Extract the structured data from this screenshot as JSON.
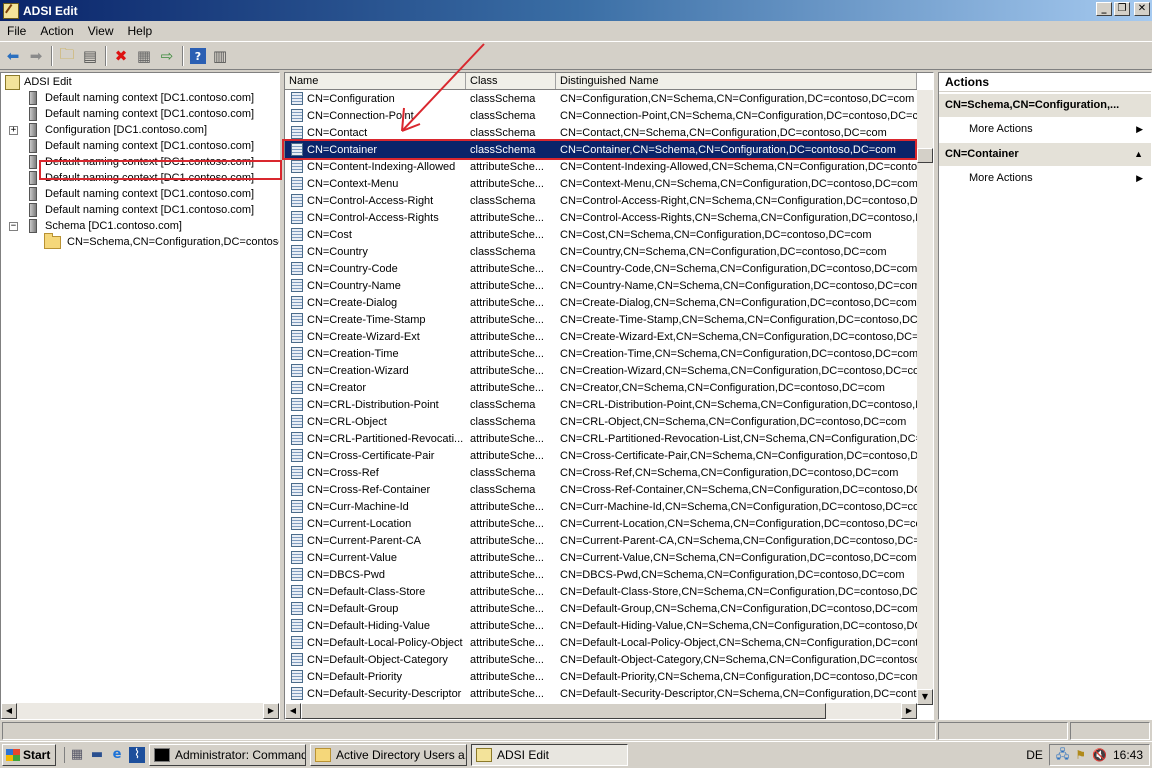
{
  "window": {
    "title": "ADSI Edit"
  },
  "menu": [
    "File",
    "Action",
    "View",
    "Help"
  ],
  "toolbar_icons": [
    "back-arrow-icon",
    "forward-arrow-icon",
    "up-folder-icon",
    "show-tree-icon",
    "delete-icon",
    "properties-icon",
    "export-list-icon",
    "help-icon",
    "show-action-pane-icon"
  ],
  "tree": {
    "root": "ADSI Edit",
    "items": [
      {
        "label": "Default naming context [DC1.contoso.com]"
      },
      {
        "label": "Default naming context [DC1.contoso.com]"
      },
      {
        "label": "Configuration [DC1.contoso.com]",
        "expander": "+"
      },
      {
        "label": "Default naming context [DC1.contoso.com]"
      },
      {
        "label": "Default naming context [DC1.contoso.com]"
      },
      {
        "label": "Default naming context [DC1.contoso.com]"
      },
      {
        "label": "Default naming context [DC1.contoso.com]"
      },
      {
        "label": "Default naming context [DC1.contoso.com]"
      },
      {
        "label": "Schema [DC1.contoso.com]",
        "expander": "−"
      }
    ],
    "selected": "CN=Schema,CN=Configuration,DC=contoso"
  },
  "list": {
    "columns": [
      "Name",
      "Class",
      "Distinguished Name"
    ],
    "rows": [
      {
        "name": "CN=Configuration",
        "class": "classSchema",
        "dn": "CN=Configuration,CN=Schema,CN=Configuration,DC=contoso,DC=com"
      },
      {
        "name": "CN=Connection-Point",
        "class": "classSchema",
        "dn": "CN=Connection-Point,CN=Schema,CN=Configuration,DC=contoso,DC=co"
      },
      {
        "name": "CN=Contact",
        "class": "classSchema",
        "dn": "CN=Contact,CN=Schema,CN=Configuration,DC=contoso,DC=com"
      },
      {
        "name": "CN=Container",
        "class": "classSchema",
        "dn": "CN=Container,CN=Schema,CN=Configuration,DC=contoso,DC=com",
        "selected": true
      },
      {
        "name": "CN=Content-Indexing-Allowed",
        "class": "attributeSche...",
        "dn": "CN=Content-Indexing-Allowed,CN=Schema,CN=Configuration,DC=contos"
      },
      {
        "name": "CN=Context-Menu",
        "class": "attributeSche...",
        "dn": "CN=Context-Menu,CN=Schema,CN=Configuration,DC=contoso,DC=com"
      },
      {
        "name": "CN=Control-Access-Right",
        "class": "classSchema",
        "dn": "CN=Control-Access-Right,CN=Schema,CN=Configuration,DC=contoso,DC"
      },
      {
        "name": "CN=Control-Access-Rights",
        "class": "attributeSche...",
        "dn": "CN=Control-Access-Rights,CN=Schema,CN=Configuration,DC=contoso,DC"
      },
      {
        "name": "CN=Cost",
        "class": "attributeSche...",
        "dn": "CN=Cost,CN=Schema,CN=Configuration,DC=contoso,DC=com"
      },
      {
        "name": "CN=Country",
        "class": "classSchema",
        "dn": "CN=Country,CN=Schema,CN=Configuration,DC=contoso,DC=com"
      },
      {
        "name": "CN=Country-Code",
        "class": "attributeSche...",
        "dn": "CN=Country-Code,CN=Schema,CN=Configuration,DC=contoso,DC=com"
      },
      {
        "name": "CN=Country-Name",
        "class": "attributeSche...",
        "dn": "CN=Country-Name,CN=Schema,CN=Configuration,DC=contoso,DC=com"
      },
      {
        "name": "CN=Create-Dialog",
        "class": "attributeSche...",
        "dn": "CN=Create-Dialog,CN=Schema,CN=Configuration,DC=contoso,DC=com"
      },
      {
        "name": "CN=Create-Time-Stamp",
        "class": "attributeSche...",
        "dn": "CN=Create-Time-Stamp,CN=Schema,CN=Configuration,DC=contoso,DC=co"
      },
      {
        "name": "CN=Create-Wizard-Ext",
        "class": "attributeSche...",
        "dn": "CN=Create-Wizard-Ext,CN=Schema,CN=Configuration,DC=contoso,DC=c"
      },
      {
        "name": "CN=Creation-Time",
        "class": "attributeSche...",
        "dn": "CN=Creation-Time,CN=Schema,CN=Configuration,DC=contoso,DC=com"
      },
      {
        "name": "CN=Creation-Wizard",
        "class": "attributeSche...",
        "dn": "CN=Creation-Wizard,CN=Schema,CN=Configuration,DC=contoso,DC=cor"
      },
      {
        "name": "CN=Creator",
        "class": "attributeSche...",
        "dn": "CN=Creator,CN=Schema,CN=Configuration,DC=contoso,DC=com"
      },
      {
        "name": "CN=CRL-Distribution-Point",
        "class": "classSchema",
        "dn": "CN=CRL-Distribution-Point,CN=Schema,CN=Configuration,DC=contoso,D"
      },
      {
        "name": "CN=CRL-Object",
        "class": "classSchema",
        "dn": "CN=CRL-Object,CN=Schema,CN=Configuration,DC=contoso,DC=com"
      },
      {
        "name": "CN=CRL-Partitioned-Revocati...",
        "class": "attributeSche...",
        "dn": "CN=CRL-Partitioned-Revocation-List,CN=Schema,CN=Configuration,DC=c"
      },
      {
        "name": "CN=Cross-Certificate-Pair",
        "class": "attributeSche...",
        "dn": "CN=Cross-Certificate-Pair,CN=Schema,CN=Configuration,DC=contoso,DC"
      },
      {
        "name": "CN=Cross-Ref",
        "class": "classSchema",
        "dn": "CN=Cross-Ref,CN=Schema,CN=Configuration,DC=contoso,DC=com"
      },
      {
        "name": "CN=Cross-Ref-Container",
        "class": "classSchema",
        "dn": "CN=Cross-Ref-Container,CN=Schema,CN=Configuration,DC=contoso,DC"
      },
      {
        "name": "CN=Curr-Machine-Id",
        "class": "attributeSche...",
        "dn": "CN=Curr-Machine-Id,CN=Schema,CN=Configuration,DC=contoso,DC=cor"
      },
      {
        "name": "CN=Current-Location",
        "class": "attributeSche...",
        "dn": "CN=Current-Location,CN=Schema,CN=Configuration,DC=contoso,DC=com"
      },
      {
        "name": "CN=Current-Parent-CA",
        "class": "attributeSche...",
        "dn": "CN=Current-Parent-CA,CN=Schema,CN=Configuration,DC=contoso,DC=co"
      },
      {
        "name": "CN=Current-Value",
        "class": "attributeSche...",
        "dn": "CN=Current-Value,CN=Schema,CN=Configuration,DC=contoso,DC=com"
      },
      {
        "name": "CN=DBCS-Pwd",
        "class": "attributeSche...",
        "dn": "CN=DBCS-Pwd,CN=Schema,CN=Configuration,DC=contoso,DC=com"
      },
      {
        "name": "CN=Default-Class-Store",
        "class": "attributeSche...",
        "dn": "CN=Default-Class-Store,CN=Schema,CN=Configuration,DC=contoso,DC=c"
      },
      {
        "name": "CN=Default-Group",
        "class": "attributeSche...",
        "dn": "CN=Default-Group,CN=Schema,CN=Configuration,DC=contoso,DC=com"
      },
      {
        "name": "CN=Default-Hiding-Value",
        "class": "attributeSche...",
        "dn": "CN=Default-Hiding-Value,CN=Schema,CN=Configuration,DC=contoso,DC"
      },
      {
        "name": "CN=Default-Local-Policy-Object",
        "class": "attributeSche...",
        "dn": "CN=Default-Local-Policy-Object,CN=Schema,CN=Configuration,DC=conto"
      },
      {
        "name": "CN=Default-Object-Category",
        "class": "attributeSche...",
        "dn": "CN=Default-Object-Category,CN=Schema,CN=Configuration,DC=contoso"
      },
      {
        "name": "CN=Default-Priority",
        "class": "attributeSche...",
        "dn": "CN=Default-Priority,CN=Schema,CN=Configuration,DC=contoso,DC=com"
      },
      {
        "name": "CN=Default-Security-Descriptor",
        "class": "attributeSche...",
        "dn": "CN=Default-Security-Descriptor,CN=Schema,CN=Configuration,DC=conto"
      }
    ]
  },
  "actions": {
    "title": "Actions",
    "sections": [
      {
        "header": "CN=Schema,CN=Configuration,...",
        "item": "More Actions"
      },
      {
        "header": "CN=Container",
        "item": "More Actions"
      }
    ]
  },
  "taskbar": {
    "start": "Start",
    "tasks": [
      "Administrator: Command...",
      "Active Directory Users a...",
      "ADSI Edit"
    ],
    "language": "DE",
    "clock": "16:43"
  },
  "colors": {
    "selection": "#0a246a",
    "annotation": "#d9272e",
    "titlebar": "#0a246a"
  }
}
